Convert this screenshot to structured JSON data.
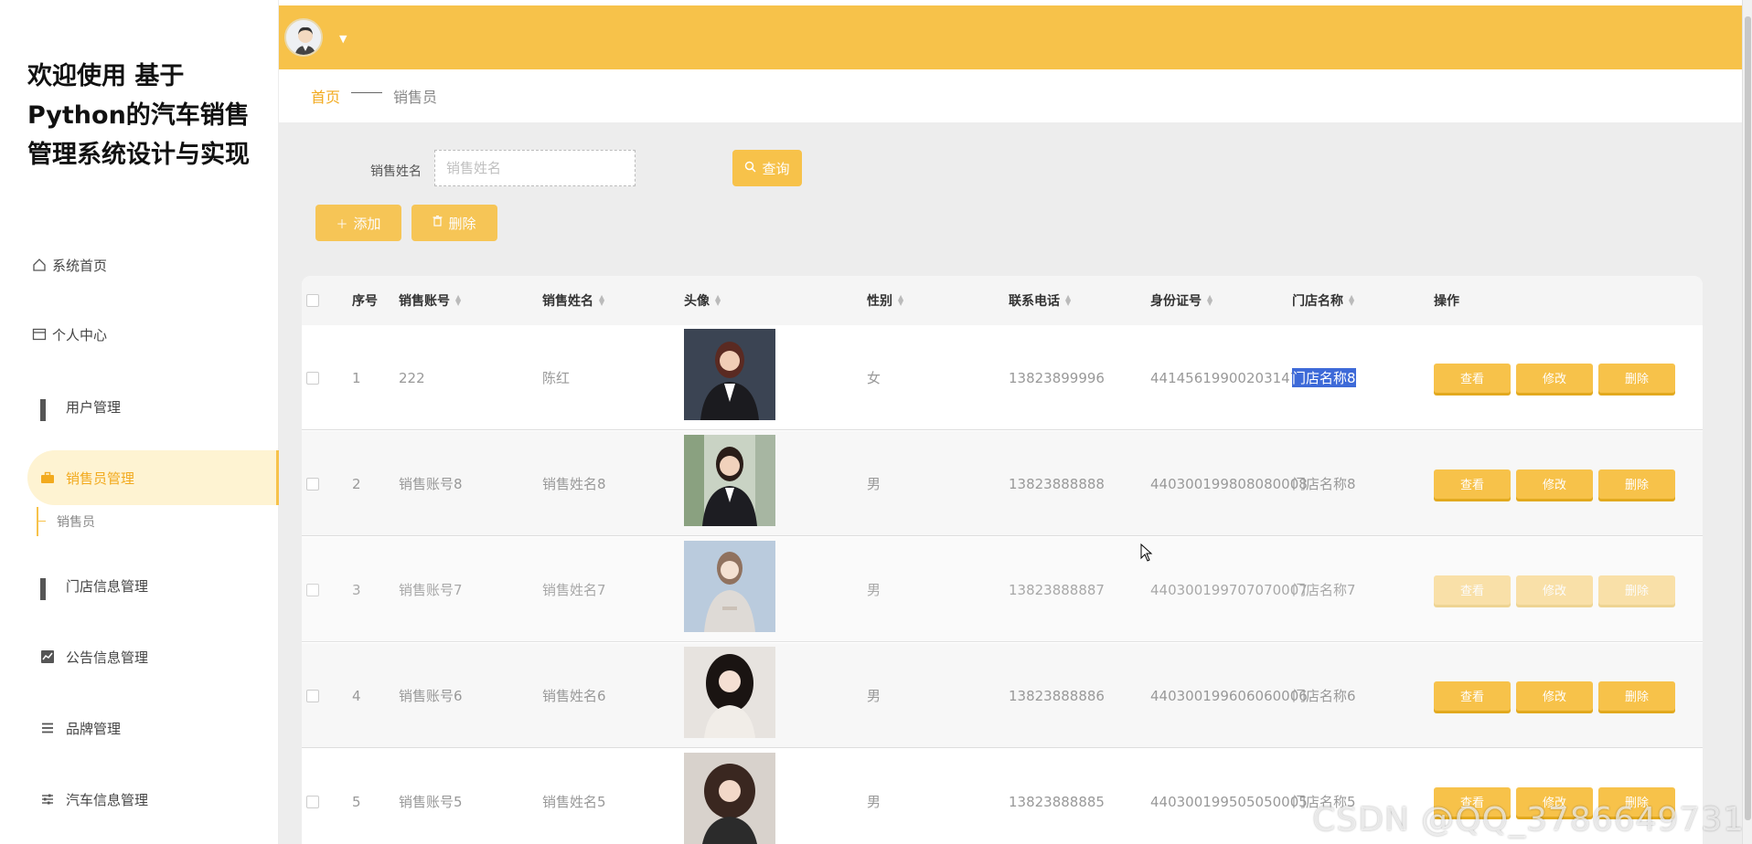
{
  "app": {
    "title": "欢迎使用 基于Python的汽车销售管理系统设计与实现"
  },
  "sidebar": {
    "items": [
      {
        "label": "系统首页",
        "icon": "home-icon"
      },
      {
        "label": "个人中心",
        "icon": "profile-card-icon"
      },
      {
        "label": "用户管理",
        "icon": "grid-icon"
      },
      {
        "label": "销售员管理",
        "icon": "briefcase-icon",
        "active": true
      },
      {
        "label": "门店信息管理",
        "icon": "grid-icon"
      },
      {
        "label": "公告信息管理",
        "icon": "chart-icon"
      },
      {
        "label": "品牌管理",
        "icon": "list-icon"
      },
      {
        "label": "汽车信息管理",
        "icon": "sliders-icon"
      }
    ],
    "sub_item": "销售员"
  },
  "breadcrumb": {
    "home": "首页",
    "current": "销售员"
  },
  "search": {
    "label": "销售姓名",
    "placeholder": "销售姓名",
    "value": ""
  },
  "buttons": {
    "query": "查询",
    "add": "添加",
    "delete": "删除"
  },
  "table": {
    "headers": [
      "序号",
      "销售账号",
      "销售姓名",
      "头像",
      "性别",
      "联系电话",
      "身份证号",
      "门店名称",
      "操作"
    ],
    "rows": [
      {
        "index": "1",
        "account": "222",
        "name": "陈红",
        "gender": "女",
        "phone": "13823899996",
        "id_card": "441456199002031478",
        "store": "门店名称8"
      },
      {
        "index": "2",
        "account": "销售账号8",
        "name": "销售姓名8",
        "gender": "男",
        "phone": "13823888888",
        "id_card": "440300199808080008",
        "store": "门店名称8"
      },
      {
        "index": "3",
        "account": "销售账号7",
        "name": "销售姓名7",
        "gender": "男",
        "phone": "13823888887",
        "id_card": "440300199707070007",
        "store": "门店名称7"
      },
      {
        "index": "4",
        "account": "销售账号6",
        "name": "销售姓名6",
        "gender": "男",
        "phone": "13823888886",
        "id_card": "440300199606060006",
        "store": "门店名称6"
      },
      {
        "index": "5",
        "account": "销售账号5",
        "name": "销售姓名5",
        "gender": "男",
        "phone": "13823888885",
        "id_card": "440300199505050005",
        "store": "门店名称5"
      }
    ],
    "row_actions": {
      "view": "查看",
      "edit": "修改",
      "delete": "删除"
    }
  },
  "watermark": "CSDN @QQ_3786649731",
  "colors": {
    "accent": "#f7c24a",
    "accent_text": "#f2aa1e",
    "active_bg": "#fef3d2",
    "selection": "#3e6ad8"
  }
}
